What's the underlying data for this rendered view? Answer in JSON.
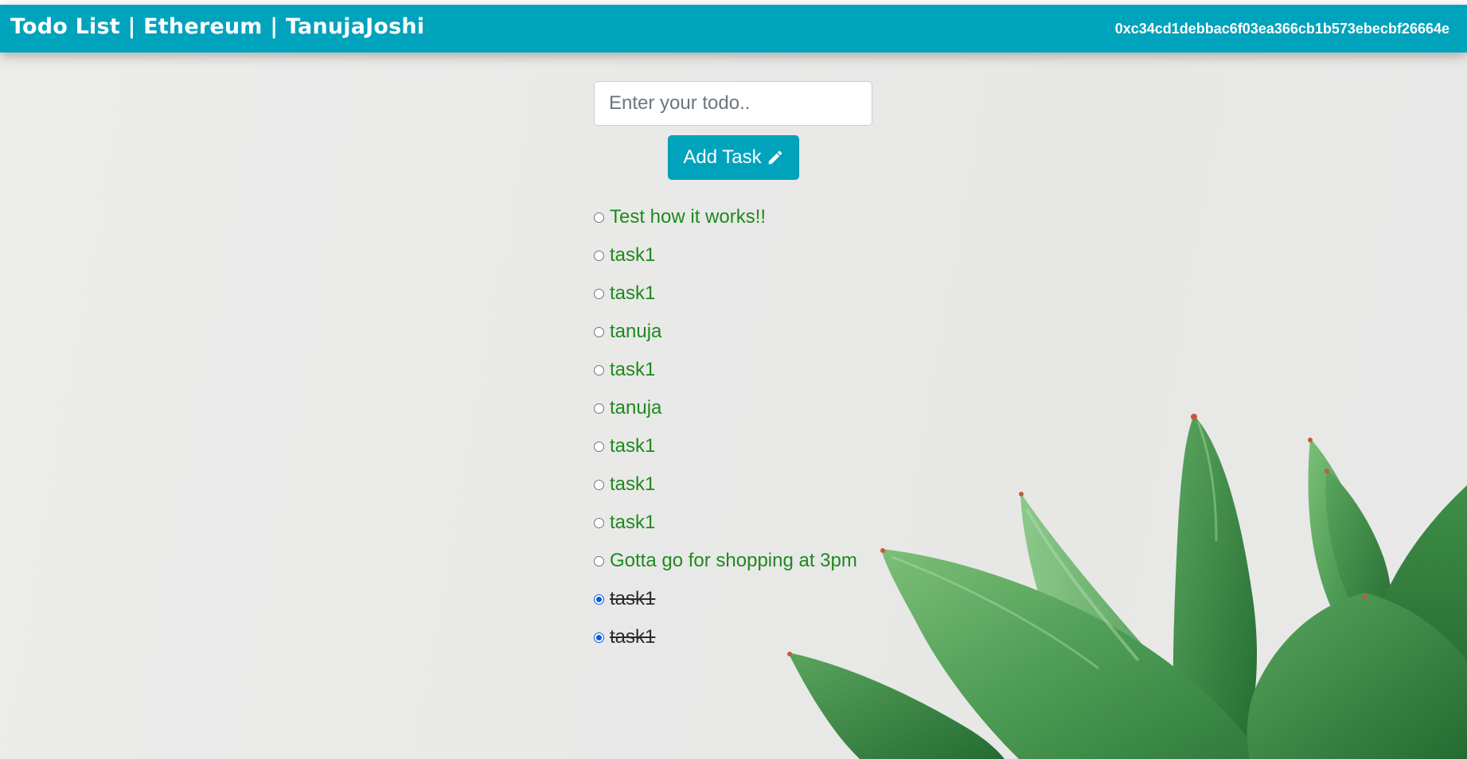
{
  "navbar": {
    "brand": "Todo List | Ethereum | TanujaJoshi",
    "account": "0xc34cd1debbac6f03ea366cb1b573ebecbf26664e",
    "color": "#00a3bc"
  },
  "form": {
    "input_placeholder": "Enter your todo..",
    "input_value": "",
    "add_button_label": "Add Task",
    "add_button_icon": "pencil-icon"
  },
  "tasks": [
    {
      "label": "Test how it works!!",
      "completed": false
    },
    {
      "label": "task1",
      "completed": false
    },
    {
      "label": "task1",
      "completed": false
    },
    {
      "label": "tanuja",
      "completed": false
    },
    {
      "label": "task1",
      "completed": false
    },
    {
      "label": "tanuja",
      "completed": false
    },
    {
      "label": "task1",
      "completed": false
    },
    {
      "label": "task1",
      "completed": false
    },
    {
      "label": "task1",
      "completed": false
    },
    {
      "label": "Gotta go for shopping at 3pm",
      "completed": false
    },
    {
      "label": "task1",
      "completed": true
    },
    {
      "label": "task1",
      "completed": true
    }
  ],
  "colors": {
    "pending_task": "#1e8a1e",
    "completed_task": "#2b2b2b",
    "accent": "#00a3bc",
    "background": "#e9e9e8"
  },
  "background_image": "succulent-plant"
}
